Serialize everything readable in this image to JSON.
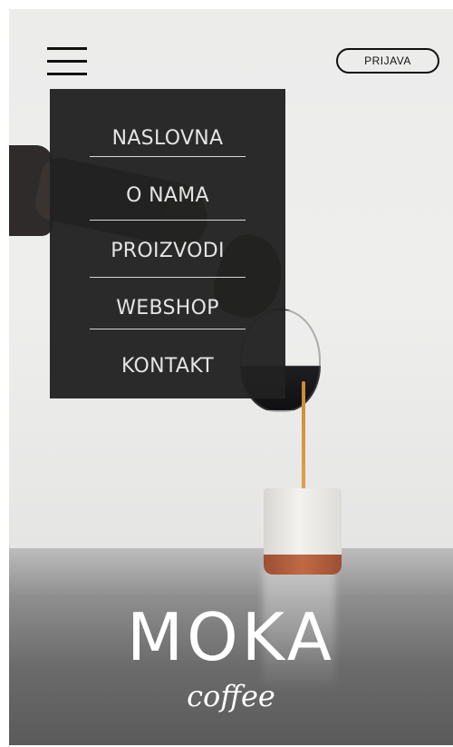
{
  "header": {
    "menu_icon": "hamburger-menu-icon",
    "login_label": "PRIJAVA"
  },
  "menu": {
    "items": [
      {
        "label": "NASLOVNA"
      },
      {
        "label": "O NAMA"
      },
      {
        "label": "PROIZVODI"
      },
      {
        "label": "WEBSHOP"
      },
      {
        "label": "KONTAKT"
      }
    ]
  },
  "logo": {
    "main": "MOKA",
    "sub": "coffee"
  },
  "colors": {
    "menu_background": "#212121",
    "menu_text": "#e4e4e4",
    "logo_text": "#ffffff",
    "header_ink": "#111111"
  }
}
